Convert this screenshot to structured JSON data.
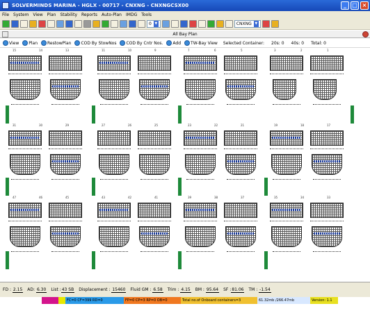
{
  "window": {
    "title": "SOLVERMINDS MARINA - HGLX - 00717 - CNXNG - CNXNGCSX00",
    "buttons": [
      "_",
      "□",
      "×"
    ]
  },
  "menu": [
    "File",
    "System",
    "View",
    "Plan",
    "Stability",
    "Reports",
    "Auto-Plan",
    "IMDG",
    "Tools"
  ],
  "toolbar": {
    "zoom_value": "0",
    "port_select": "CNXNG"
  },
  "doc": {
    "title": "All Bay Plan"
  },
  "viewbar": {
    "options": [
      "View",
      "Plan",
      "RestowPlan",
      "COD By StowNos",
      "COD By Cntr Nos.",
      "Add",
      "TW-Bay View"
    ],
    "selected_label": "Selected Container:",
    "c20_label": "20s:",
    "c20_value": "0",
    "c40_label": "40s:",
    "c40_value": "0",
    "total_label": "Total:",
    "total_value": "0"
  },
  "bays": {
    "row1": [
      "15",
      "14",
      "13",
      "11",
      "10",
      "9",
      "7",
      "6",
      "5",
      "3",
      "2",
      "1"
    ],
    "row2": [
      "31",
      "30",
      "29",
      "27",
      "26",
      "25",
      "23",
      "22",
      "21",
      "19",
      "18",
      "17"
    ],
    "row3": [
      "47",
      "46",
      "45",
      "43",
      "42",
      "41",
      "39",
      "38",
      "37",
      "35",
      "34",
      "33"
    ]
  },
  "status": {
    "fd_label": "FD :",
    "fd": "2.15",
    "ad_label": "AD:",
    "ad": "6.30",
    "list_label": "List :",
    "list": "43 SB",
    "disp_label": "Displacement :",
    "disp": "15460",
    "gm_label": "Fluid GM :",
    "gm": "6.58",
    "trim_label": "Trim :",
    "trim": "4.15",
    "bm_label": "BM :",
    "bm": "95.64",
    "sf_label": "SF :",
    "sf": "81.06",
    "tm_label": "TM :",
    "tm": "-1.54"
  },
  "legend": {
    "fc": "FC=0 CF=399 RD=0",
    "fp": "FP=0 CP=3 RP=0 OB=0",
    "onboard": "Total no.of Onboard containers=3",
    "memory": "61.32mb /266.47mb",
    "version": "Version: 1.1"
  }
}
